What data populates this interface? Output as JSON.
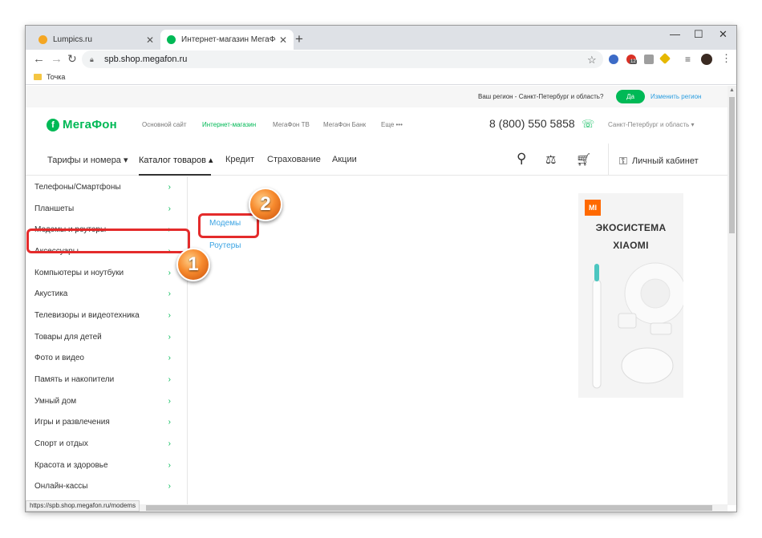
{
  "browser": {
    "tabs": [
      {
        "label": "Lumpics.ru",
        "active": false
      },
      {
        "label": "Интернет-магазин МегаФон в С",
        "active": true
      }
    ],
    "new_tab": "+",
    "window_controls": {
      "minimize": "—",
      "maximize": "☐",
      "close": "✕"
    },
    "url": "spb.shop.megafon.ru",
    "bookmark": "Точка",
    "ext_badge": "12",
    "status_url": "https://spb.shop.megafon.ru/modems"
  },
  "region_bar": {
    "question": "Ваш регион - Санкт-Петербург и область?",
    "yes": "Да",
    "change": "Изменить регион"
  },
  "header": {
    "logo_text": "МегаФон",
    "logo_mark": "f",
    "links": [
      "Основной сайт",
      "Интернет-магазин",
      "МегаФон ТВ",
      "МегаФон Банк",
      "Еще •••"
    ],
    "phone": "8 (800) 550 5858",
    "city": "Санкт-Петербург и область ▾"
  },
  "main_nav": {
    "items": [
      "Тарифы и номера ▾",
      "Каталог товаров ▴",
      "Кредит",
      "Страхование",
      "Акции"
    ],
    "cabinet": "Личный кабинет"
  },
  "sidebar": {
    "categories": [
      "Телефоны/Смартфоны",
      "Планшеты",
      "Модемы и роутеры",
      "Аксессуары",
      "Компьютеры и ноутбуки",
      "Акустика",
      "Телевизоры и видеотехника",
      "Товары для детей",
      "Фото и видео",
      "Память и накопители",
      "Умный дом",
      "Игры и развлечения",
      "Спорт и отдых",
      "Красота и здоровье",
      "Онлайн-кассы"
    ],
    "chevron": "›"
  },
  "subcategories": [
    "Модемы",
    "Роутеры"
  ],
  "banner": {
    "brand": "MI",
    "title_line1": "ЭКОСИСТЕМА",
    "title_line2": "XIAOMI"
  },
  "callouts": {
    "step1": "1",
    "step2": "2"
  },
  "colors": {
    "brand_green": "#00b956",
    "link_blue": "#3aa3e3",
    "highlight_red": "#e42b2b"
  }
}
